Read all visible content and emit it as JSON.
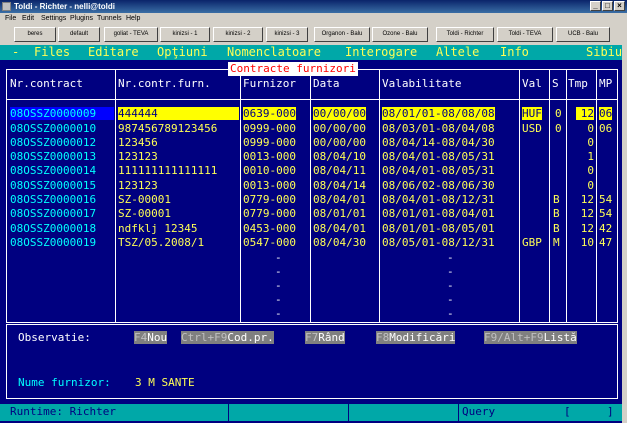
{
  "window": {
    "title": "Toldi - Richter  -  nelli@toldi"
  },
  "menubar": [
    "File",
    "Edit",
    "Settings",
    "Plugins",
    "Tunnels",
    "Help"
  ],
  "toolbar": [
    "beres",
    "default",
    "goliat - TEVA",
    "kinizsi - 1",
    "kinizsi - 2",
    "kinizsi - 3",
    "Organon - Balu",
    "Ozone - Balu",
    "Toldi - Richter",
    "Toldi - TEVA",
    "UCB - Balu"
  ],
  "app_menu": [
    "-",
    "Files",
    "Editare",
    "Opţiuni",
    "Nomenclatoare",
    "Interogare",
    "Altele",
    "Info",
    "Sibiu"
  ],
  "form": {
    "title": "Contracte furnizori",
    "headers": {
      "contract": "Nr.contract",
      "furn": "Nr.contr.furn.",
      "furnizor": "Furnizor",
      "data": "Data",
      "valabilitate": "Valabilitate",
      "val": "Val",
      "s": "S",
      "tmp": "Tmp",
      "mp": "MP"
    },
    "rows": [
      {
        "contract": "08OSSZ0000009",
        "furn": "444444",
        "furnizor": "0639-000",
        "data": "00/00/00",
        "valab": "08/01/01-08/08/08",
        "val": "HUF",
        "s": "0",
        "tmp": "12",
        "mp": "06"
      },
      {
        "contract": "08OSSZ0000010",
        "furn": "987456789123456",
        "furnizor": "0999-000",
        "data": "00/00/00",
        "valab": "08/03/01-08/04/08",
        "val": "USD",
        "s": "0",
        "tmp": "0",
        "mp": "06"
      },
      {
        "contract": "08OSSZ0000012",
        "furn": "123456",
        "furnizor": "0999-000",
        "data": "00/00/00",
        "valab": "08/04/14-08/04/30",
        "val": "",
        "s": "",
        "tmp": "0",
        "mp": ""
      },
      {
        "contract": "08OSSZ0000013",
        "furn": "123123",
        "furnizor": "0013-000",
        "data": "08/04/10",
        "valab": "08/04/01-08/05/31",
        "val": "",
        "s": "",
        "tmp": "1",
        "mp": ""
      },
      {
        "contract": "08OSSZ0000014",
        "furn": "111111111111111",
        "furnizor": "0010-000",
        "data": "08/04/11",
        "valab": "08/04/01-08/05/31",
        "val": "",
        "s": "",
        "tmp": "0",
        "mp": ""
      },
      {
        "contract": "08OSSZ0000015",
        "furn": "123123",
        "furnizor": "0013-000",
        "data": "08/04/14",
        "valab": "08/06/02-08/06/30",
        "val": "",
        "s": "",
        "tmp": "0",
        "mp": ""
      },
      {
        "contract": "08OSSZ0000016",
        "furn": "SZ-00001",
        "furnizor": "0779-000",
        "data": "08/04/01",
        "valab": "08/04/01-08/12/31",
        "val": "",
        "s": "B",
        "tmp": "12",
        "mp": "54"
      },
      {
        "contract": "08OSSZ0000017",
        "furn": "SZ-00001",
        "furnizor": "0779-000",
        "data": "08/01/01",
        "valab": "08/01/01-08/04/01",
        "val": "",
        "s": "B",
        "tmp": "12",
        "mp": "54"
      },
      {
        "contract": "08OSSZ0000018",
        "furn": "ndfklj 12345",
        "furnizor": "0453-000",
        "data": "08/04/01",
        "valab": "08/01/01-08/05/01",
        "val": "",
        "s": "B",
        "tmp": "12",
        "mp": "42"
      },
      {
        "contract": "08OSSZ0000019",
        "furn": "TSZ/05.2008/1",
        "furnizor": "0547-000",
        "data": "08/04/30",
        "valab": "08/05/01-08/12/31",
        "val": "GBP",
        "s": "M",
        "tmp": "10",
        "mp": "47"
      }
    ],
    "empty_dash": "-",
    "observatie_label": "Observatie:",
    "fkeys": [
      {
        "key": "F4",
        "label": "Nou"
      },
      {
        "key": "Ctrl+F9",
        "label": "Cod.pr."
      },
      {
        "key": "F7",
        "label": "Rând"
      },
      {
        "key": "F8",
        "label": "Modificări"
      },
      {
        "key": "F9/Alt+F9",
        "label": "Listă"
      }
    ],
    "nume_furnizor_label": "Nume furnizor:",
    "nume_furnizor_value": "3 M SANTE"
  },
  "status": {
    "runtime": "Runtime: Richter",
    "mode": "Query",
    "bracket_open": "[",
    "bracket_close": "]"
  },
  "colors": {
    "console_bg": "#000080",
    "menu_bg": "#00a8a8",
    "highlight": "#ffff00",
    "text": "#ffff55",
    "contract_text": "#00ffff"
  }
}
